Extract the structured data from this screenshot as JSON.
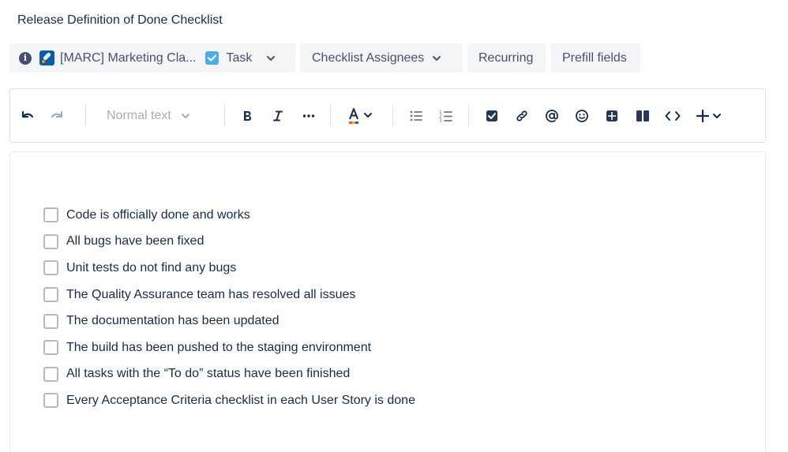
{
  "title": "Release Definition of Done Checklist",
  "meta_bar": {
    "project_name": "[MARC] Marketing Cla...",
    "issue_type": "Task",
    "assignees_label": "Checklist Assignees",
    "recurring_label": "Recurring",
    "prefill_label": "Prefill fields"
  },
  "toolbar": {
    "text_style": "Normal text",
    "icons": [
      "undo-icon",
      "redo-icon",
      "bold-icon",
      "italic-icon",
      "more-formatting-icon",
      "text-color-icon",
      "bullet-list-icon",
      "numbered-list-icon",
      "action-item-icon",
      "link-icon",
      "mention-icon",
      "emoji-icon",
      "table-icon",
      "layout-icon",
      "code-icon",
      "insert-plus-icon"
    ]
  },
  "checklist": {
    "items": [
      {
        "text": "Code is officially done and works",
        "checked": false
      },
      {
        "text": "All bugs have been fixed",
        "checked": false
      },
      {
        "text": "Unit tests do not find any bugs",
        "checked": false
      },
      {
        "text": "The Quality Assurance team has resolved all issues",
        "checked": false
      },
      {
        "text": "The documentation has been updated",
        "checked": false
      },
      {
        "text": "The build has been pushed to the staging environment",
        "checked": false
      },
      {
        "text": "All tasks with the “To do” status have been finished",
        "checked": false
      },
      {
        "text": "Every Acceptance Criteria checklist in each User Story is done",
        "checked": false
      }
    ]
  },
  "colors": {
    "text_primary": "#172b4d",
    "text_secondary": "#42526e",
    "chip_bg": "#f4f5f7",
    "task_blue": "#4bade8",
    "border": "#dfe1e6"
  }
}
